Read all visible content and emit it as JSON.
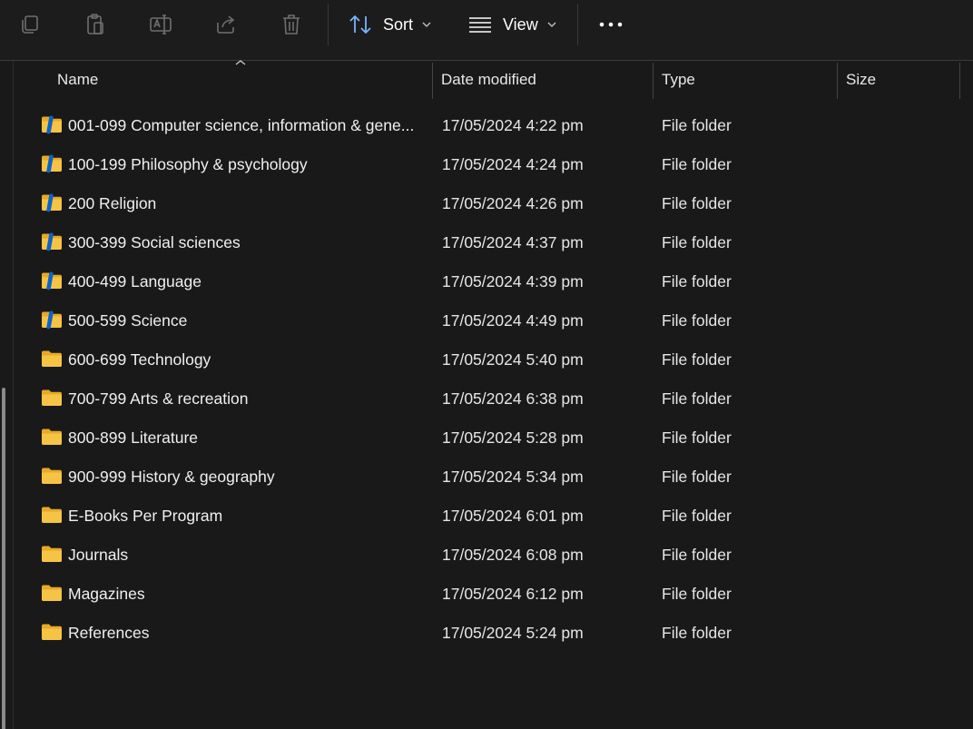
{
  "toolbar": {
    "sort_label": "Sort",
    "view_label": "View",
    "icons": [
      "copy-icon",
      "paste-icon",
      "rename-icon",
      "share-icon",
      "delete-icon",
      "sort-icon",
      "view-icon",
      "more-icon"
    ]
  },
  "columns": {
    "name": "Name",
    "date_modified": "Date modified",
    "type": "Type",
    "size": "Size"
  },
  "colors": {
    "background": "#191919",
    "folder": "#f6c445",
    "sync_badge": "#0a64c8"
  },
  "files": [
    {
      "name": "001-099 Computer science, information & gene...",
      "date": "17/05/2024 4:22 pm",
      "type": "File folder",
      "size": "",
      "badge": true
    },
    {
      "name": "100-199 Philosophy & psychology",
      "date": "17/05/2024 4:24 pm",
      "type": "File folder",
      "size": "",
      "badge": true
    },
    {
      "name": "200 Religion",
      "date": "17/05/2024 4:26 pm",
      "type": "File folder",
      "size": "",
      "badge": true
    },
    {
      "name": "300-399 Social sciences",
      "date": "17/05/2024 4:37 pm",
      "type": "File folder",
      "size": "",
      "badge": true
    },
    {
      "name": "400-499 Language",
      "date": "17/05/2024 4:39 pm",
      "type": "File folder",
      "size": "",
      "badge": true
    },
    {
      "name": "500-599 Science",
      "date": "17/05/2024 4:49 pm",
      "type": "File folder",
      "size": "",
      "badge": true
    },
    {
      "name": "600-699 Technology",
      "date": "17/05/2024 5:40 pm",
      "type": "File folder",
      "size": "",
      "badge": false
    },
    {
      "name": "700-799 Arts & recreation",
      "date": "17/05/2024 6:38 pm",
      "type": "File folder",
      "size": "",
      "badge": false
    },
    {
      "name": "800-899 Literature",
      "date": "17/05/2024 5:28 pm",
      "type": "File folder",
      "size": "",
      "badge": false
    },
    {
      "name": "900-999 History & geography",
      "date": "17/05/2024 5:34 pm",
      "type": "File folder",
      "size": "",
      "badge": false
    },
    {
      "name": "E-Books Per Program",
      "date": "17/05/2024 6:01 pm",
      "type": "File folder",
      "size": "",
      "badge": false
    },
    {
      "name": "Journals",
      "date": "17/05/2024 6:08 pm",
      "type": "File folder",
      "size": "",
      "badge": false
    },
    {
      "name": "Magazines",
      "date": "17/05/2024 6:12 pm",
      "type": "File folder",
      "size": "",
      "badge": false
    },
    {
      "name": "References",
      "date": "17/05/2024 5:24 pm",
      "type": "File folder",
      "size": "",
      "badge": false
    }
  ]
}
